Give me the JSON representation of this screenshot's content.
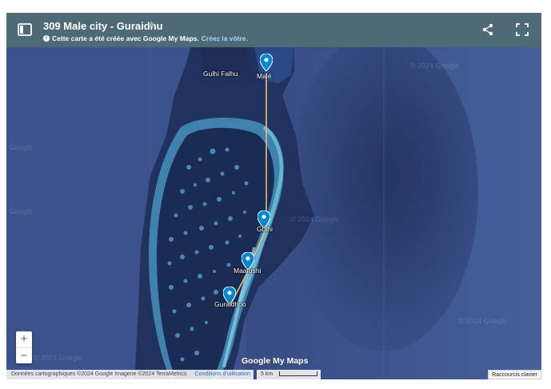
{
  "header": {
    "title": "309 Male city - Guraidhu",
    "subtitle_text": "Cette carte a été créée avec Google My Maps.",
    "subtitle_link": "Créez la vôtre.",
    "info_icon_text": "i"
  },
  "places": [
    {
      "name": "Gulhi Falhu",
      "pin": false
    },
    {
      "name": "Malé",
      "pin": true
    },
    {
      "name": "Gulhi",
      "pin": true
    },
    {
      "name": "Maafushi",
      "pin": true
    },
    {
      "name": "Guraidhoo",
      "pin": true
    }
  ],
  "route": {
    "color": "#e8c070",
    "stops": [
      "Malé",
      "Gulhi",
      "Maafushi",
      "Guraidhoo"
    ]
  },
  "pin_color": "#0288d1",
  "zoom": {
    "in_label": "+",
    "out_label": "−"
  },
  "logo": "Google My Maps",
  "footer": {
    "attribution": "Données cartographiques ©2024 Google Imagerie ©2024 TerraMetrics",
    "terms": "Conditions d'utilisation",
    "scale": "5 km",
    "shortcuts": "Raccourcis clavier"
  },
  "watermarks": {
    "google": "Google",
    "year": "© 2024 Google"
  }
}
